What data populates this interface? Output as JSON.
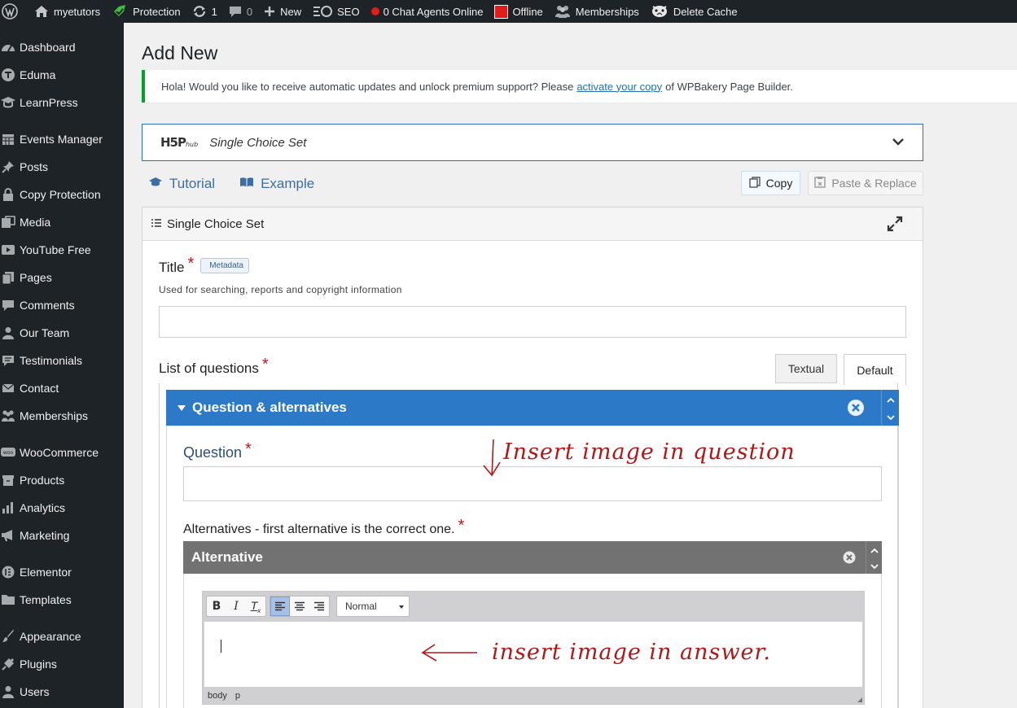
{
  "adminbar": {
    "site_name": "myetutors",
    "protection": "Protection",
    "updates_count": "1",
    "comments_count": "0",
    "new_label": "New",
    "seo_label": "SEO",
    "chat_label": "0 Chat Agents Online",
    "offline_label": "Offline",
    "memberships_label": "Memberships",
    "delete_cache_label": "Delete Cache"
  },
  "sidebar": {
    "items": [
      {
        "label": "Dashboard",
        "icon": "dashboard-icon"
      },
      {
        "label": "Eduma",
        "icon": "eduma-icon"
      },
      {
        "label": "LearnPress",
        "icon": "learnpress-icon"
      },
      {
        "label": "Events Manager",
        "icon": "calendar-icon"
      },
      {
        "label": "Posts",
        "icon": "pin-icon"
      },
      {
        "label": "Copy Protection",
        "icon": "lock-icon"
      },
      {
        "label": "Media",
        "icon": "media-icon"
      },
      {
        "label": "YouTube Free",
        "icon": "youtube-icon"
      },
      {
        "label": "Pages",
        "icon": "pages-icon"
      },
      {
        "label": "Comments",
        "icon": "comment-icon"
      },
      {
        "label": "Our Team",
        "icon": "person-icon"
      },
      {
        "label": "Testimonials",
        "icon": "testimonial-icon"
      },
      {
        "label": "Contact",
        "icon": "mail-icon"
      },
      {
        "label": "Memberships",
        "icon": "group-icon"
      },
      {
        "label": "WooCommerce",
        "icon": "woo-icon"
      },
      {
        "label": "Products",
        "icon": "archive-icon"
      },
      {
        "label": "Analytics",
        "icon": "chart-icon"
      },
      {
        "label": "Marketing",
        "icon": "megaphone-icon"
      },
      {
        "label": "Elementor",
        "icon": "elementor-icon"
      },
      {
        "label": "Templates",
        "icon": "folder-icon"
      },
      {
        "label": "Appearance",
        "icon": "brush-icon"
      },
      {
        "label": "Plugins",
        "icon": "plug-icon"
      },
      {
        "label": "Users",
        "icon": "users-icon"
      }
    ]
  },
  "page": {
    "title": "Add New",
    "notice_before": "Hola! Would you like to receive automatic updates and unlock premium support? Please",
    "notice_link": "activate your copy",
    "notice_after": "of WPBakery Page Builder."
  },
  "h5p": {
    "content_type": "Single Choice Set",
    "tutorial": "Tutorial",
    "example": "Example",
    "copy": "Copy",
    "paste_replace": "Paste & Replace",
    "editor_title": "Single Choice Set",
    "title_label": "Title",
    "metadata_tag": "Metadata",
    "title_desc": "Used for searching, reports and copyright information",
    "title_value": "",
    "list_label": "List of questions",
    "tab_textual": "Textual",
    "tab_default": "Default",
    "group_title": "Question & alternatives",
    "question_label": "Question",
    "question_value": "",
    "alternatives_label": "Alternatives - first alternative is the correct one.",
    "alternative_title": "Alternative",
    "format_select": "Normal",
    "path_body": "body",
    "path_p": "p"
  },
  "annotations": {
    "question_note": "Insert image in question",
    "answer_note": "insert image in answer."
  },
  "colors": {
    "accent": "#2c79c8",
    "admin_dark": "#1d2327",
    "required": "#c0161c",
    "annotation": "#b21818"
  }
}
